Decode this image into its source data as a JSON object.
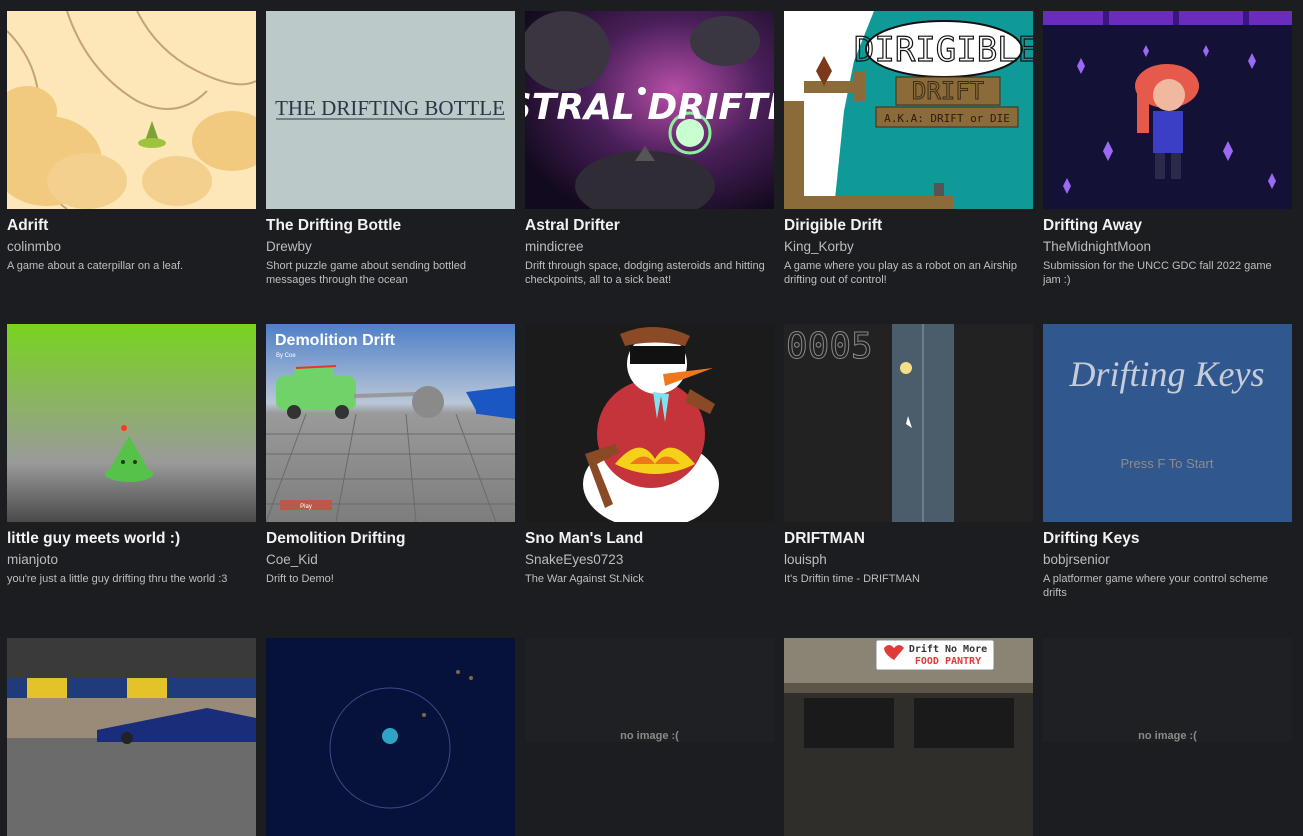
{
  "games": [
    {
      "title": "Adrift",
      "author": "colinmbo",
      "description": "A game about a caterpillar on a leaf."
    },
    {
      "title": "The Drifting Bottle",
      "author": "Drewby",
      "description": "Short puzzle game about sending bottled messages through the ocean",
      "thumb_text": "THE DRIFTING BOTTLE"
    },
    {
      "title": "Astral Drifter",
      "author": "mindicree",
      "description": "Drift through space, dodging asteroids and hitting checkpoints, all to a sick beat!",
      "thumb_text": "STRAL DRIFTE"
    },
    {
      "title": "Dirigible Drift",
      "author": "King_Korby",
      "description": "A game where you play as a robot on an Airship drifting out of control!",
      "thumb_text": {
        "big": "DIRIGIBLE",
        "sign": "DRIFT",
        "sub": "A.K.A: DRIFT or DIE"
      }
    },
    {
      "title": "Drifting Away",
      "author": "TheMidnightMoon",
      "description": "Submission for the UNCC GDC fall 2022 game jam :)"
    },
    {
      "title": "little guy meets world :)",
      "author": "mianjoto",
      "description": "you're just a little guy drifting thru the world :3"
    },
    {
      "title": "Demolition Drifting",
      "author": "Coe_Kid",
      "description": "Drift to Demo!",
      "thumb_text": {
        "heading": "Demolition Drift",
        "by": "By Coe",
        "button": "Play"
      }
    },
    {
      "title": "Sno Man's Land",
      "author": "SnakeEyes0723",
      "description": "The War Against St.Nick"
    },
    {
      "title": "DRIFTMAN",
      "author": "louisph",
      "description": "It's Driftin time - DRIFTMAN",
      "thumb_text": "0005"
    },
    {
      "title": "Drifting Keys",
      "author": "bobjrsenior",
      "description": "A platformer game where your control scheme drifts",
      "thumb_text": {
        "heading": "Drifting Keys",
        "prompt": "Press F To Start"
      }
    },
    {
      "title": "",
      "author": "",
      "description": ""
    },
    {
      "title": "",
      "author": "",
      "description": ""
    },
    {
      "title": "",
      "author": "",
      "description": "",
      "no_image": "no image :("
    },
    {
      "title": "",
      "author": "",
      "description": "",
      "thumb_text": {
        "line1": "Drift No More",
        "line2": "FOOD PANTRY"
      }
    },
    {
      "title": "",
      "author": "",
      "description": "",
      "no_image": "no image :("
    }
  ]
}
